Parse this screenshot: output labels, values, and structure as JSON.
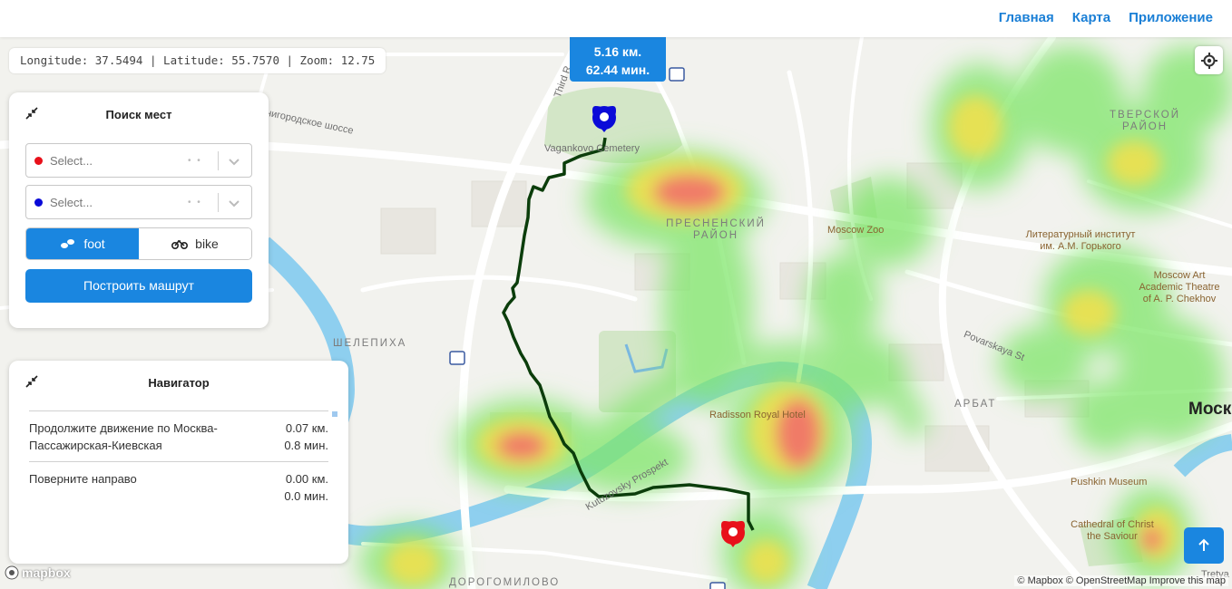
{
  "nav": {
    "links": [
      "Главная",
      "Карта",
      "Приложение"
    ]
  },
  "coords_text": "Longitude: 37.5494 | Latitude: 55.7570 | Zoom: 12.75",
  "route_badge": {
    "distance": "5.16 км.",
    "time": "62.44 мин."
  },
  "search_panel": {
    "title": "Поиск мест",
    "from_placeholder": "Select...",
    "to_placeholder": "Select...",
    "from_color": "#e8101a",
    "to_color": "#0a0ad8",
    "modes": [
      "foot",
      "bike"
    ],
    "active_mode": "foot",
    "build_button": "Построить машрут"
  },
  "navigator": {
    "title": "Навигатор",
    "steps": [
      {
        "text": "Продолжите движение по Москва-Пассажирская-Киевская",
        "distance": "0.07 км.",
        "time": "0.8 мин."
      },
      {
        "text": "Поверните направо",
        "distance": "0.00 км.",
        "time": "0.0 мин."
      }
    ]
  },
  "map_labels": {
    "cemetery": "Vagankovo Cemetery",
    "third_ring": "Third R",
    "highway": "енигородское шоссе",
    "presnensky": "ПРЕСНЕНСКИЙ РАЙОН",
    "tverskoy": "ТВЕРСКОЙ РАЙОН",
    "zoo": "Moscow Zoo",
    "lit_institute": "Литературный институт им. А.М. Горького",
    "art_theatre": "Moscow Art Academic Theatre of A. P. Chekhov",
    "povarskaya": "Povarskaya St",
    "shelepikha": "ШЕЛЕПИХА",
    "arbat": "АРБАТ",
    "radisson": "Radisson Royal Hotel",
    "kutuzovsky": "Kutuzovsky Prospekt",
    "pushkin": "Pushkin Museum",
    "cathedral": "Cathedral of Christ the Saviour",
    "dorogomilovo": "ДОРОГОМИЛОВО",
    "moscow": "Моск",
    "tretya": "Tretya"
  },
  "mapbox_logo": "mapbox",
  "attribution": "© Mapbox © OpenStreetMap Improve this map",
  "colors": {
    "accent": "#1a86e0",
    "route": "#0b3d0b",
    "river": "#8ecfef"
  },
  "icons": [
    "crosshair-icon",
    "collapse-icon",
    "chevron-down-icon",
    "foot-icon",
    "bike-icon",
    "arrow-up-icon",
    "start-pin-icon",
    "end-pin-icon"
  ]
}
